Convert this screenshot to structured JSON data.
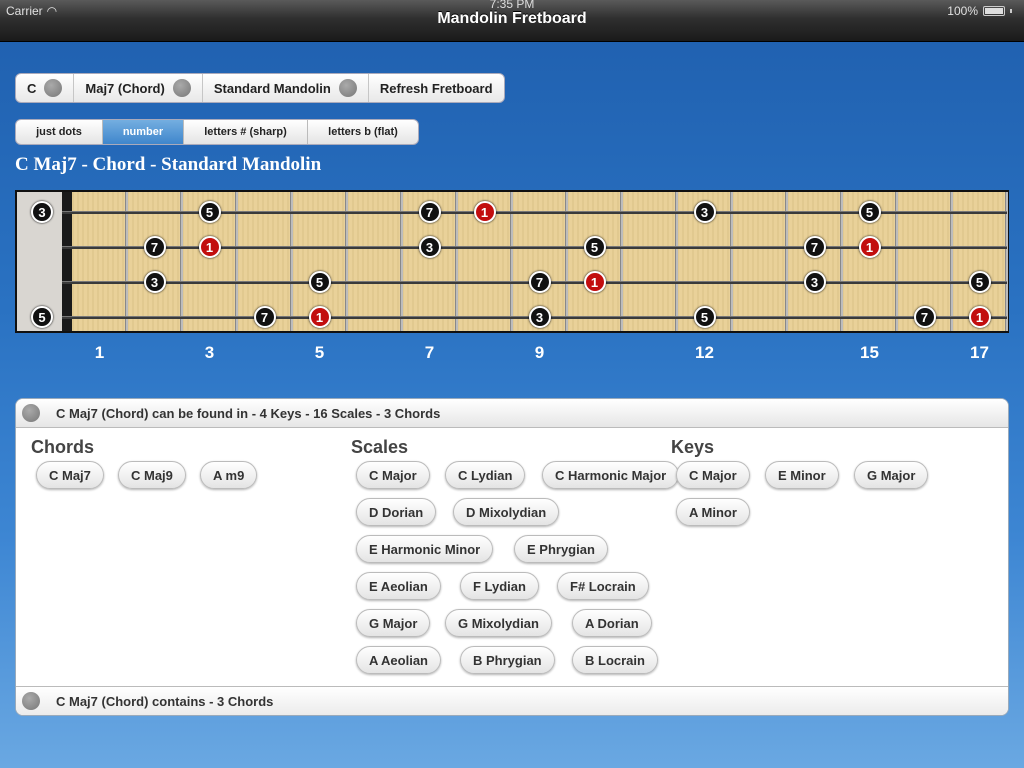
{
  "status": {
    "carrier": "Carrier",
    "time": "7:35 PM",
    "battery": "100%"
  },
  "nav": {
    "title": "Mandolin Fretboard"
  },
  "selector": {
    "key": "C",
    "chord": "Maj7 (Chord)",
    "tuning": "Standard Mandolin",
    "refresh": "Refresh Fretboard"
  },
  "display_modes": {
    "options": [
      "just dots",
      "number",
      "letters # (sharp)",
      "letters b (flat)"
    ],
    "selected": "number"
  },
  "chord_title": "C Maj7 - Chord - Standard Mandolin",
  "fretboard": {
    "open_notes": [
      "3",
      "5"
    ],
    "fret_markers": [
      "1",
      "3",
      "5",
      "7",
      "9",
      "12",
      "15",
      "17"
    ],
    "notes": [
      {
        "string": 1,
        "fret": 0,
        "label": "3",
        "root": false
      },
      {
        "string": 1,
        "fret": 3,
        "label": "5",
        "root": false
      },
      {
        "string": 1,
        "fret": 7,
        "label": "7",
        "root": false
      },
      {
        "string": 1,
        "fret": 8,
        "label": "1",
        "root": true
      },
      {
        "string": 1,
        "fret": 12,
        "label": "3",
        "root": false
      },
      {
        "string": 1,
        "fret": 15,
        "label": "5",
        "root": false
      },
      {
        "string": 2,
        "fret": 2,
        "label": "7",
        "root": false
      },
      {
        "string": 2,
        "fret": 3,
        "label": "1",
        "root": true
      },
      {
        "string": 2,
        "fret": 7,
        "label": "3",
        "root": false
      },
      {
        "string": 2,
        "fret": 10,
        "label": "5",
        "root": false
      },
      {
        "string": 2,
        "fret": 14,
        "label": "7",
        "root": false
      },
      {
        "string": 2,
        "fret": 15,
        "label": "1",
        "root": true
      },
      {
        "string": 3,
        "fret": 2,
        "label": "3",
        "root": false
      },
      {
        "string": 3,
        "fret": 5,
        "label": "5",
        "root": false
      },
      {
        "string": 3,
        "fret": 9,
        "label": "7",
        "root": false
      },
      {
        "string": 3,
        "fret": 10,
        "label": "1",
        "root": true
      },
      {
        "string": 3,
        "fret": 14,
        "label": "3",
        "root": false
      },
      {
        "string": 3,
        "fret": 17,
        "label": "5",
        "root": false
      },
      {
        "string": 4,
        "fret": 0,
        "label": "5",
        "root": false
      },
      {
        "string": 4,
        "fret": 4,
        "label": "7",
        "root": false
      },
      {
        "string": 4,
        "fret": 5,
        "label": "1",
        "root": true
      },
      {
        "string": 4,
        "fret": 9,
        "label": "3",
        "root": false
      },
      {
        "string": 4,
        "fret": 12,
        "label": "5",
        "root": false
      },
      {
        "string": 4,
        "fret": 16,
        "label": "7",
        "root": false
      },
      {
        "string": 4,
        "fret": 17,
        "label": "1",
        "root": true
      }
    ]
  },
  "found_in": {
    "header": "C Maj7 (Chord) can be found in - 4 Keys - 16 Scales - 3 Chords",
    "chords_title": "Chords",
    "chords": [
      "C Maj7",
      "C Maj9",
      "A m9"
    ],
    "scales_title": "Scales",
    "scales": [
      [
        "C Major",
        "C Lydian",
        "C Harmonic Major"
      ],
      [
        "D Dorian",
        "D Mixolydian"
      ],
      [
        "E Harmonic Minor",
        "E Phrygian"
      ],
      [
        "E Aeolian",
        "F Lydian",
        "F# Locrain"
      ],
      [
        "G Major",
        "G Mixolydian",
        "A Dorian"
      ],
      [
        "A Aeolian",
        "B Phrygian",
        "B Locrain"
      ]
    ],
    "keys_title": "Keys",
    "keys": [
      [
        "C Major",
        "E Minor",
        "G Major"
      ],
      [
        "A Minor"
      ]
    ]
  },
  "contains": {
    "footer": "C Maj7 (Chord) contains - 3 Chords"
  },
  "colors": {
    "root": "#c20e0e",
    "note": "#111111",
    "selected_segment": "#3f86cc"
  }
}
